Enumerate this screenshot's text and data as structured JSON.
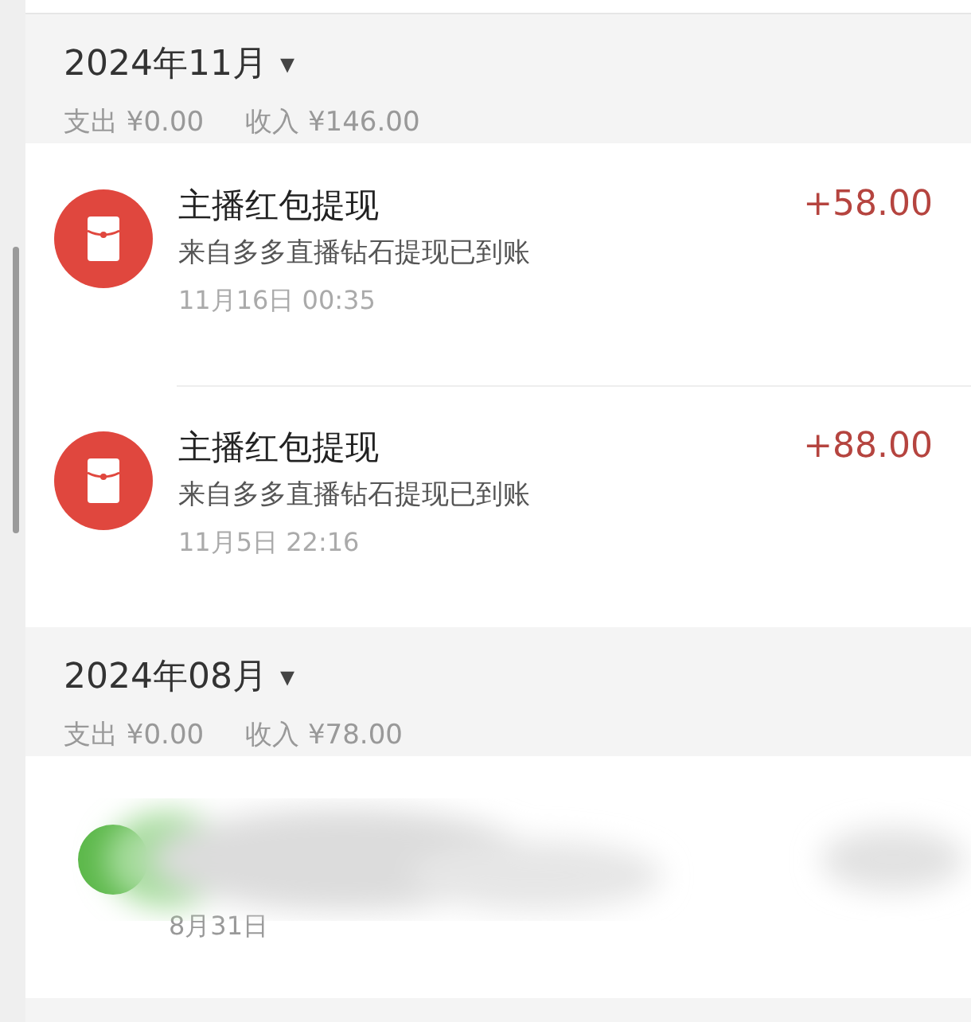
{
  "months": [
    {
      "title": "2024年11月",
      "caret": "▾",
      "expense": "支出 ¥0.00",
      "income": "收入 ¥146.00",
      "records": [
        {
          "kind": "red_packet",
          "title": "主播红包提现",
          "note": "来自多多直播钻石提现已到账",
          "time": "11月16日 00:35",
          "amount": "+58.00"
        },
        {
          "kind": "red_packet",
          "title": "主播红包提现",
          "note": "来自多多直播钻石提现已到账",
          "time": "11月5日 22:16",
          "amount": "+88.00"
        }
      ]
    },
    {
      "title": "2024年08月",
      "caret": "▾",
      "expense": "支出 ¥0.00",
      "income": "收入 ¥78.00",
      "records": [
        {
          "kind": "redacted",
          "time": "8月31日"
        }
      ]
    }
  ]
}
